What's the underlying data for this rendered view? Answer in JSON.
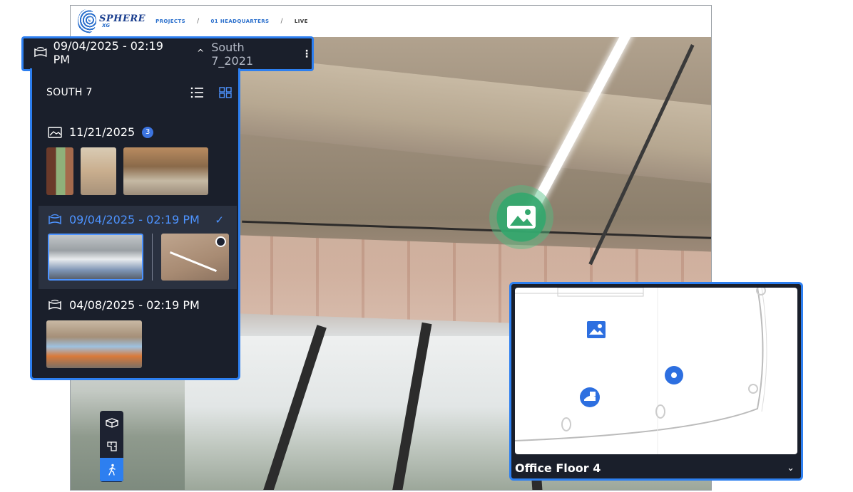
{
  "topbar": {
    "logo_main": "SPHERE",
    "logo_sub": "XG",
    "breadcrumb": [
      "PROJECTS",
      "01 HEADQUARTERS",
      "LIVE"
    ]
  },
  "selector": {
    "date": "09/04/2025 - 02:19 PM",
    "name": "South 7_2021",
    "chevron": "^",
    "menu": "⋮"
  },
  "dropdown": {
    "title": "SOUTH 7",
    "view_list_icon": "list-view-icon",
    "view_grid_icon": "grid-view-icon",
    "groups": [
      {
        "date": "11/21/2025",
        "badge": "3",
        "icon": "photo-icon"
      },
      {
        "date": "09/04/2025 - 02:19 PM",
        "icon": "360-capture-icon",
        "selected": true,
        "check": "✓"
      },
      {
        "date": "04/08/2025 - 02:19 PM",
        "icon": "360-capture-icon"
      }
    ]
  },
  "minimap": {
    "floor": "Office Floor 4",
    "chevron": "⌄"
  },
  "colors": {
    "accent": "#2d7ff0",
    "panel": "#1a1f2b",
    "selected_text": "#4d93ff",
    "marker_green": "#34a86e"
  }
}
